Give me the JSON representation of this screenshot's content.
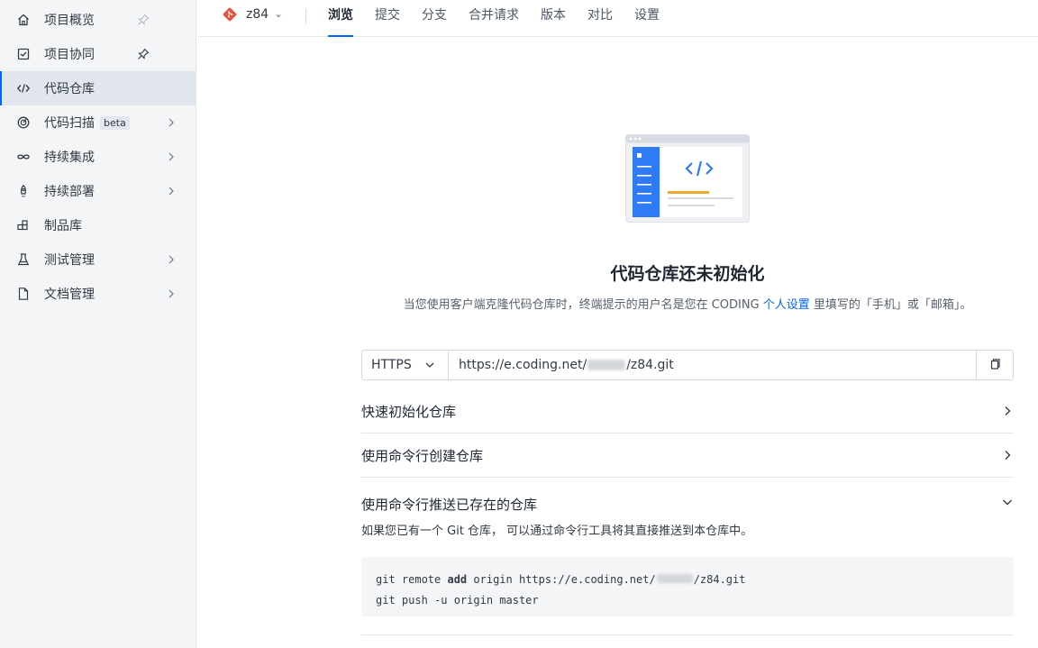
{
  "sidebar": {
    "items": [
      {
        "label": "项目概览",
        "icon": "home-icon"
      },
      {
        "label": "项目协同",
        "icon": "checkbox-icon"
      },
      {
        "label": "代码仓库",
        "icon": "code-icon"
      },
      {
        "label": "代码扫描",
        "icon": "scan-icon",
        "badge": "beta"
      },
      {
        "label": "持续集成",
        "icon": "infinity-icon"
      },
      {
        "label": "持续部署",
        "icon": "rocket-icon"
      },
      {
        "label": "制品库",
        "icon": "package-icon"
      },
      {
        "label": "测试管理",
        "icon": "flask-icon"
      },
      {
        "label": "文档管理",
        "icon": "document-icon"
      }
    ]
  },
  "header": {
    "repo_name": "z84",
    "tabs": [
      {
        "label": "浏览"
      },
      {
        "label": "提交"
      },
      {
        "label": "分支"
      },
      {
        "label": "合并请求"
      },
      {
        "label": "版本"
      },
      {
        "label": "对比"
      },
      {
        "label": "设置"
      }
    ]
  },
  "main": {
    "title": "代码仓库还未初始化",
    "desc_prefix": "当您使用客户端克隆代码仓库时，终端提示的用户名是您在 CODING ",
    "desc_link": "个人设置",
    "desc_suffix": " 里填写的「手机」或「邮箱」。",
    "clone": {
      "protocol": "HTTPS",
      "url_prefix": "https://e.coding.net/",
      "url_suffix": "/z84.git"
    },
    "sections": [
      {
        "label": "快速初始化仓库"
      },
      {
        "label": "使用命令行创建仓库"
      },
      {
        "label": "使用命令行推送已存在的仓库"
      }
    ],
    "push_text": "如果您已有一个 Git 仓库， 可以通过命令行工具将其直接推送到本仓库中。",
    "code": {
      "line1_a": "git remote ",
      "line1_kw": "add",
      "line1_b": " origin https://e.coding.net/",
      "line1_c": "/z84.git",
      "line2": "git push -u origin master"
    }
  },
  "colors": {
    "accent": "#0066ff",
    "illus_blue": "#2f7bf5",
    "illus_yellow": "#f0a92e"
  }
}
